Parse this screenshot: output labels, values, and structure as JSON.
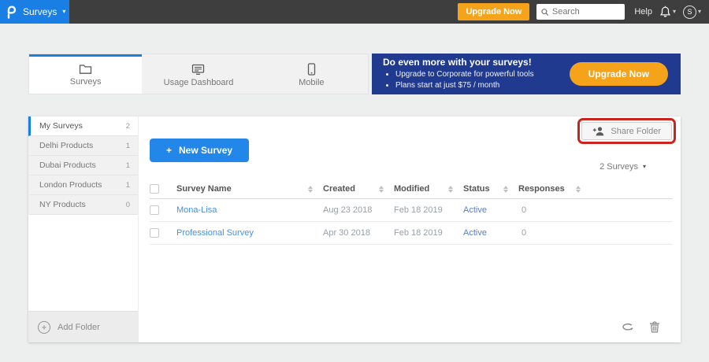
{
  "topbar": {
    "app_menu": "Surveys",
    "upgrade_button": "Upgrade Now",
    "search_placeholder": "Search",
    "help": "Help",
    "avatar_initial": "S"
  },
  "tabs": [
    {
      "label": "Surveys",
      "active": true
    },
    {
      "label": "Usage Dashboard",
      "active": false
    },
    {
      "label": "Mobile",
      "active": false
    }
  ],
  "banner": {
    "title": "Do even more with your surveys!",
    "bullets": [
      "Upgrade to Corporate for powerful tools",
      "Plans start at just $75 / month"
    ],
    "cta": "Upgrade Now"
  },
  "sidebar": {
    "items": [
      {
        "label": "My Surveys",
        "count": "2",
        "active": true
      },
      {
        "label": "Delhi Products",
        "count": "1",
        "active": false
      },
      {
        "label": "Dubai Products",
        "count": "1",
        "active": false
      },
      {
        "label": "London Products",
        "count": "1",
        "active": false
      },
      {
        "label": "NY Products",
        "count": "0",
        "active": false
      }
    ],
    "add_folder": "Add Folder"
  },
  "main": {
    "share_folder": "Share Folder",
    "new_survey": "New Survey",
    "count_dropdown": "2 Surveys",
    "table": {
      "headers": [
        "Survey Name",
        "Created",
        "Modified",
        "Status",
        "Responses"
      ],
      "rows": [
        {
          "name": "Mona-Lisa",
          "created": "Aug 23 2018",
          "modified": "Feb 18 2019",
          "status": "Active",
          "responses": "0"
        },
        {
          "name": "Professional Survey",
          "created": "Apr 30 2018",
          "modified": "Feb 18 2019",
          "status": "Active",
          "responses": "0"
        }
      ]
    }
  },
  "icons": {
    "plus": "+",
    "caret": "▾",
    "names": [
      "proprofs-logo",
      "search-icon",
      "bell-icon",
      "avatar",
      "folder-icon",
      "dashboard-icon",
      "mobile-icon",
      "person-add-icon",
      "plus-circle-icon",
      "sort-icon",
      "restore-icon",
      "trash-icon"
    ]
  },
  "colors": {
    "accent_blue": "#1a7fe4",
    "button_blue": "#2287e8",
    "orange": "#f5a31a",
    "banner_navy": "#203a90",
    "annotation_red": "#c9251c",
    "link_blue": "#4a90d9",
    "status_blue": "#5b7fc4",
    "topbar_dark": "#3e3e3e"
  }
}
